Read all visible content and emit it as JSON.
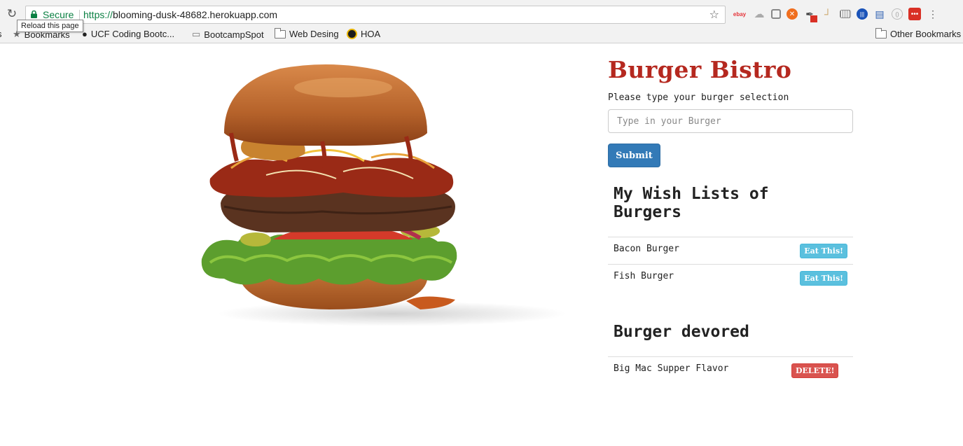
{
  "browser": {
    "secure_label": "Secure",
    "url_scheme": "https://",
    "url_host": "blooming-dusk-48682.herokuapp.com",
    "tooltip": "Reload this page",
    "extensions": [
      "ebay",
      "drive",
      "ext-a",
      "ext-b",
      "ext-c",
      "ext-d",
      "ext-e",
      "ext-f",
      "ext-g",
      "ext-h",
      "ext-i",
      "ext-j"
    ]
  },
  "bookmarks": {
    "items": [
      {
        "label": "Bookmarks",
        "icon": "star-icon"
      },
      {
        "label": "UCF Coding Bootc...",
        "icon": "github-icon"
      },
      {
        "label": "BootcampSpot",
        "icon": "page-icon"
      },
      {
        "label": "Web Desing",
        "icon": "folder-icon"
      },
      {
        "label": "HOA",
        "icon": "hoa-icon"
      }
    ],
    "other": "Other Bookmarks"
  },
  "page": {
    "title": "Burger Bistro",
    "prompt": "Please type your burger selection",
    "input_placeholder": "Type in your Burger",
    "submit_label": "Submit",
    "wish_heading": "My Wish Lists of Burgers",
    "wish_items": [
      {
        "name": "Bacon Burger",
        "action": "Eat This!"
      },
      {
        "name": "Fish Burger",
        "action": "Eat This!"
      }
    ],
    "devored_heading": "Burger devored",
    "devored_items": [
      {
        "name": "Big Mac Supper Flavor",
        "action": "DELETE!"
      }
    ]
  },
  "colors": {
    "title": "#b5281f",
    "submit": "#337ab7",
    "eat": "#5bc0de",
    "delete": "#d9534f"
  }
}
